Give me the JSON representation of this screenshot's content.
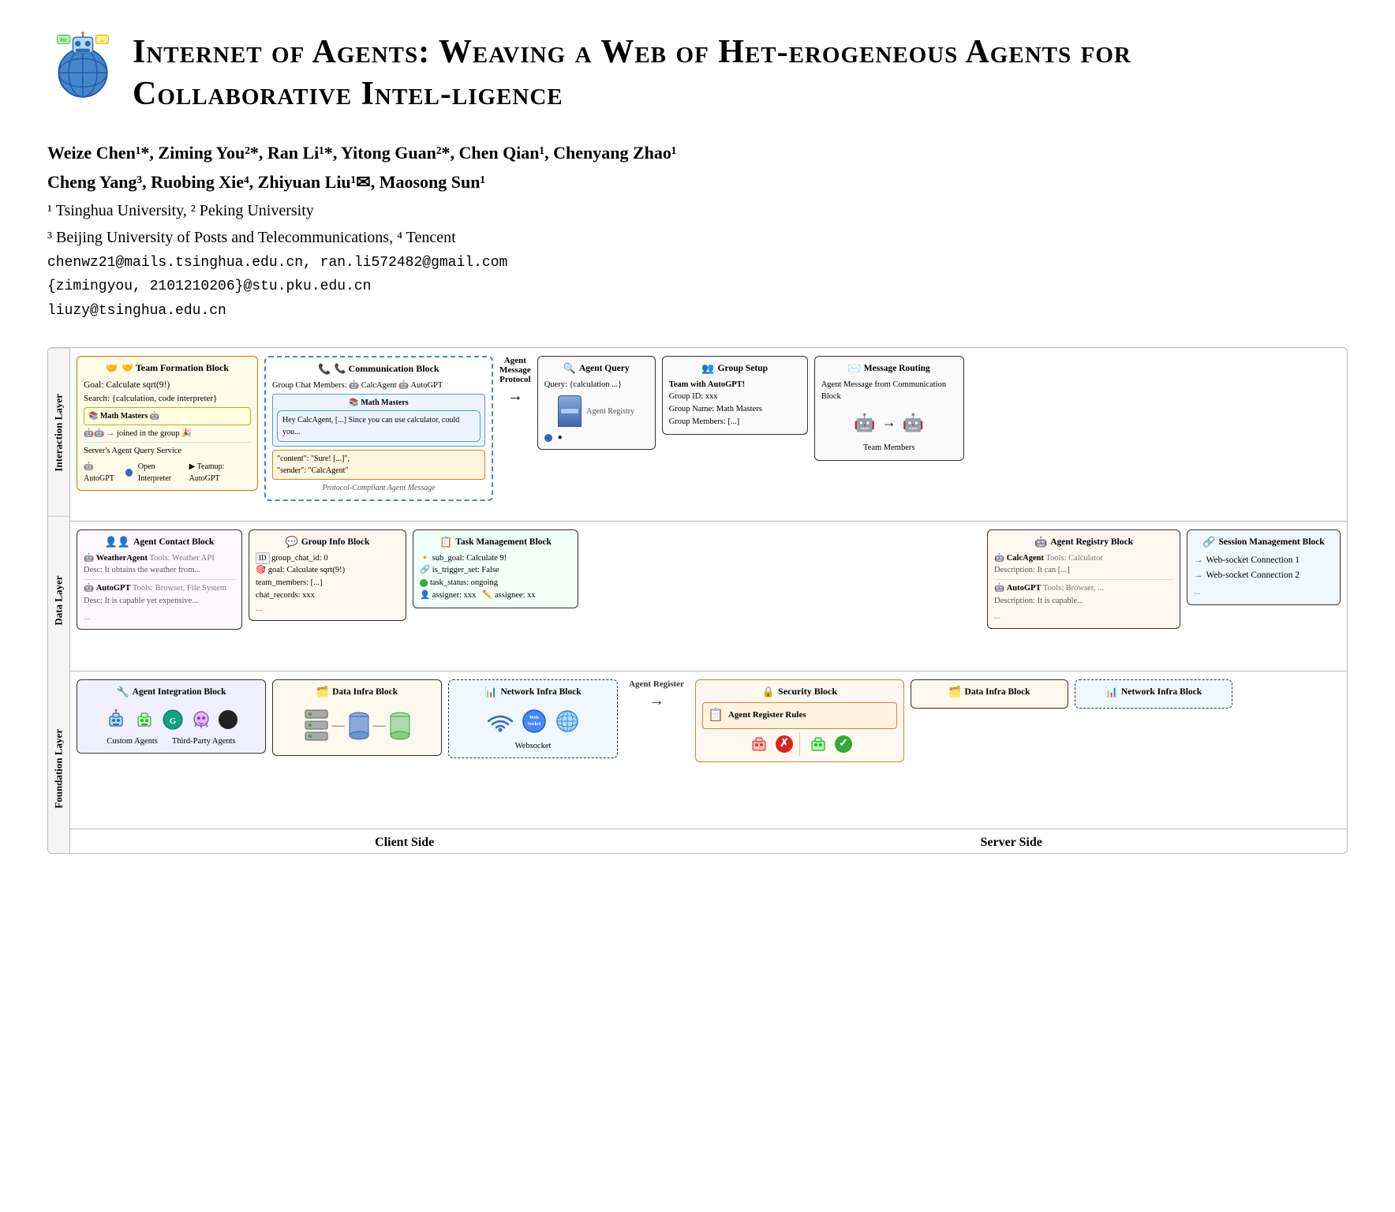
{
  "paper": {
    "title": "Internet of Agents: Weaving a Web of Heterogeneous Agents for Collaborative Intelligence",
    "title_display": "Internet of Agents: Weaving a Web of Het-erogeneous Agents for Collaborative Intel-ligence",
    "authors_line1": "Weize Chen¹*, Ziming You²*, Ran Li¹*, Yitong Guan²*, Chen Qian¹, Chenyang Zhao¹",
    "authors_line2": "Cheng Yang³, Ruobing Xie⁴, Zhiyuan Liu¹✉, Maosong Sun¹",
    "affil1": "¹ Tsinghua University, ² Peking University",
    "affil2": "³ Beijing University of Posts and Telecommunications, ⁴ Tencent",
    "email1": "chenwz21@mails.tsinghua.edu.cn,   ran.li572482@gmail.com",
    "email2": "{zimingyou, 2101210206}@stu.pku.edu.cn",
    "email3": "liuzy@tsinghua.edu.cn"
  },
  "layers": {
    "interaction": "Interaction Layer",
    "data": "Data Layer",
    "foundation": "Foundation Layer"
  },
  "blocks": {
    "team_formation": {
      "title": "🤝 Team Formation Block",
      "goal": "Goal: Calculate sqrt(9!)",
      "search": "Search: {calculation, code interpreter}",
      "server_query": "Server's Agent Query Service",
      "agents": "AutoGPT ● Open Interpreter ▶ Teamup: AutoGPT"
    },
    "communication": {
      "title": "📞 Communication Block",
      "members": "Group Chat Members: 🤖 CalcAgent 🤖 AutoGPT",
      "chat_group": "Math Masters",
      "joined": "joined in the group 🎉",
      "bubble1": "Hey CalcAgent, [...] Since you can use calculator, could you...",
      "bubble2": "\"content\": \"Sure! [...]\", \"sender\": \"CalcAgent\"",
      "protocol_label": "Protocol-Compliant Agent Message"
    },
    "agent_query": {
      "title": "🔍 Agent Query",
      "query": "Query: {calculation ...}",
      "sub": "Agent Message Protocol"
    },
    "group_setup": {
      "title": "👥 Group Setup",
      "line1": "Team with AutoGPT!",
      "group_id": "Group ID: xxx",
      "group_name": "Group Name: Math Masters",
      "group_members": "Group Members: [...]"
    },
    "message_routing": {
      "title": "✉️ Message Routing",
      "line1": "Agent Message from Communication Block",
      "sub": "Team Members"
    },
    "agent_contact": {
      "title": "👤👤 Agent Contact Block",
      "entry1_name": "WeatherAgent",
      "entry1_tools": "Tools: Weather API",
      "entry1_desc": "Desc: It obtains the weather from...",
      "entry2_name": "AutoGPT",
      "entry2_tools": "Tools: Browser, File System",
      "entry2_desc": "Desc: It is capable yet expensive..."
    },
    "group_info": {
      "title": "💬 Group Info Block",
      "id": "group_chat_id: 0",
      "goal": "goal: Calculate sqrt(9!)",
      "members": "team_members: [...]",
      "chat": "chat_records: xxx",
      "ellipsis": "..."
    },
    "task_mgmt": {
      "title": "📋 Task Management Block",
      "sub_goal": "sub_goal: Calculate 9!",
      "trigger": "is_trigger_set: False",
      "status": "task_status: ongoing",
      "assigner": "assigner: xxx",
      "assignee": "assignee: xx"
    },
    "agent_registry": {
      "title": "🤖 Agent Registry Block",
      "entry1_name": "CalcAgent",
      "entry1_tools": "Tools: Calculator",
      "entry1_desc": "Description: It can [...]",
      "entry2_name": "AutoGPT",
      "entry2_tools": "Tools: Browser, ...",
      "entry2_desc": "Description: It is capable...",
      "ellipsis": "..."
    },
    "session_mgmt": {
      "title": "🔗 Session Management Block",
      "conn1": "Web-socket Connection 1",
      "conn2": "Web-socket Connection 2",
      "ellipsis": "..."
    },
    "agent_integration": {
      "title": "🔧 Agent Integration Block",
      "custom": "Custom Agents",
      "third_party": "Third-Party Agents"
    },
    "data_infra_client": {
      "title": "🗂️ Data Infra Block"
    },
    "network_infra_client": {
      "title": "📊 Network Infra Block",
      "websocket": "Websocket"
    },
    "security": {
      "title": "🔒 Security Block",
      "rules": "Agent Register Rules",
      "approve_label": "✓",
      "deny_label": "✗"
    },
    "data_infra_server": {
      "title": "🗂️ Data Infra Block"
    },
    "network_infra_server": {
      "title": "📊 Network Infra Block"
    }
  },
  "labels": {
    "client_side": "Client Side",
    "server_side": "Server Side",
    "agent_register": "Agent Register",
    "agent_protocol": "Agent Message Protocol"
  }
}
